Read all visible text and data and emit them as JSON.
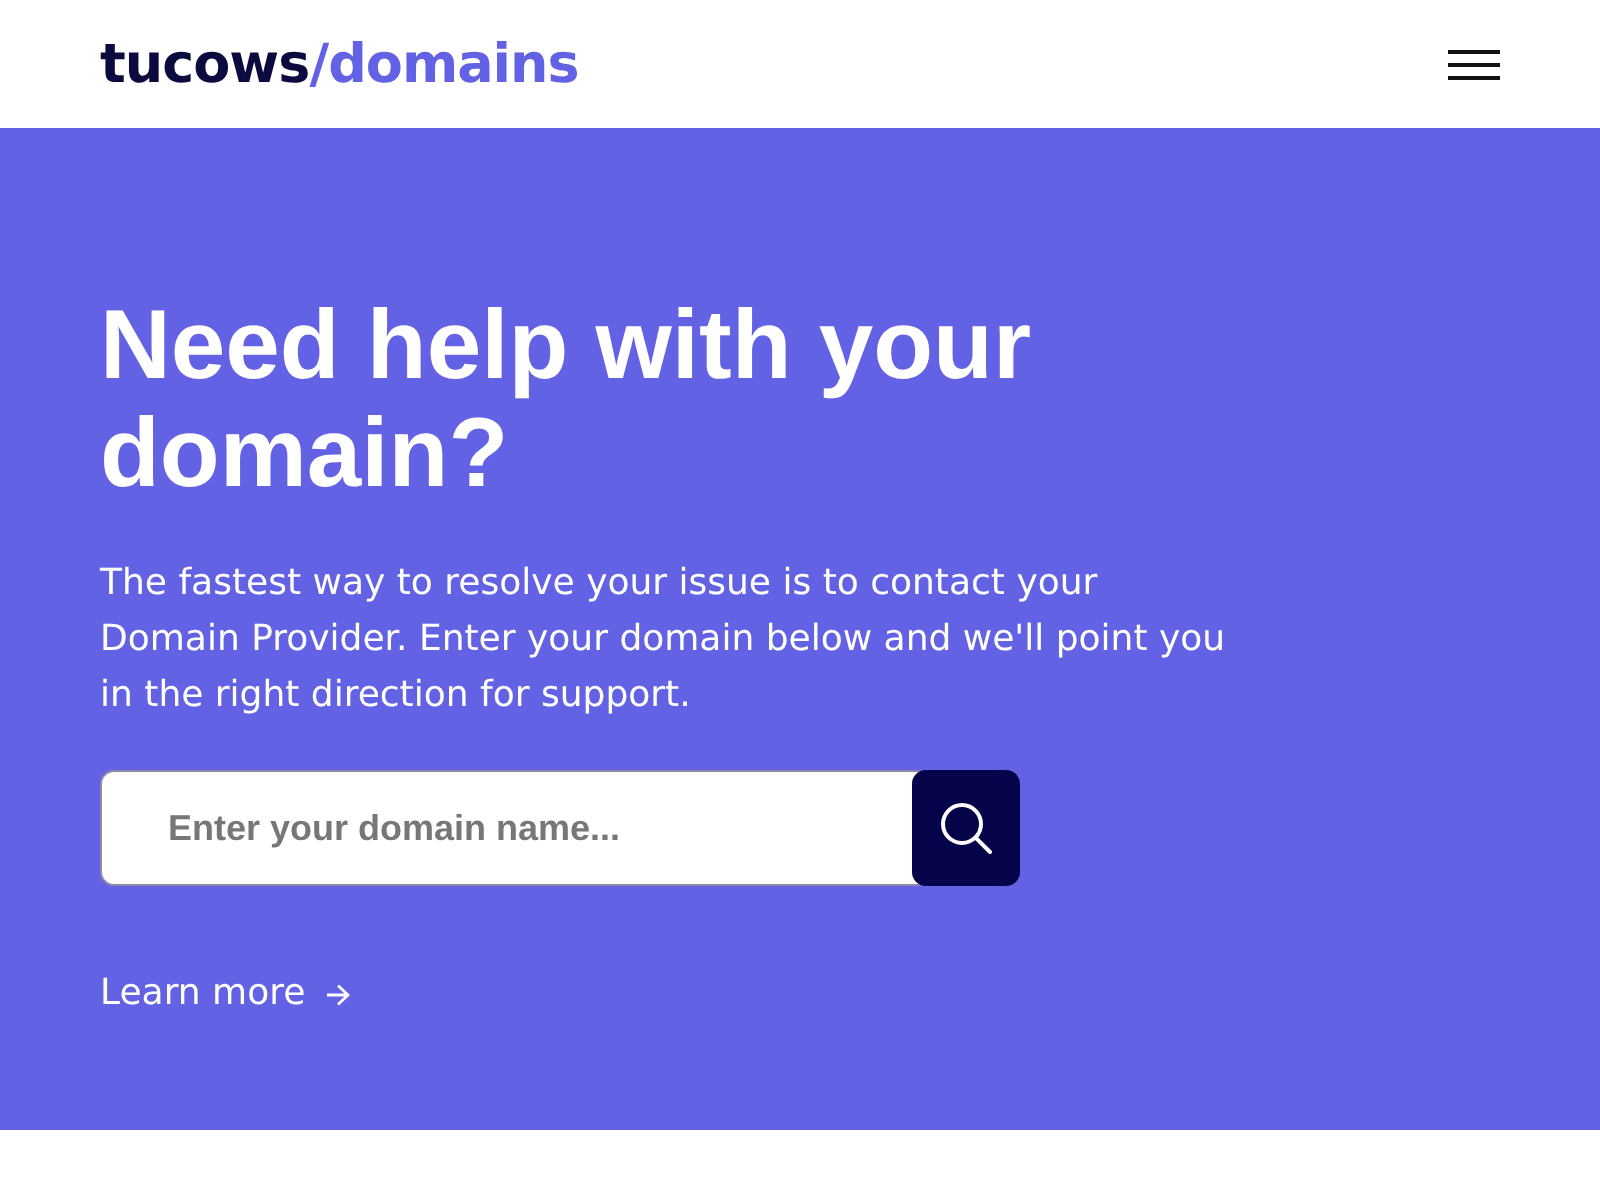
{
  "header": {
    "logo": {
      "brand": "tucows",
      "product": "/domains"
    }
  },
  "hero": {
    "title": "Need help with your domain?",
    "description": "The fastest way to resolve your issue is to contact your Domain Provider. Enter your domain below and we'll point you in the right direction for support.",
    "search": {
      "placeholder": "Enter your domain name..."
    },
    "link": "Learn more"
  }
}
